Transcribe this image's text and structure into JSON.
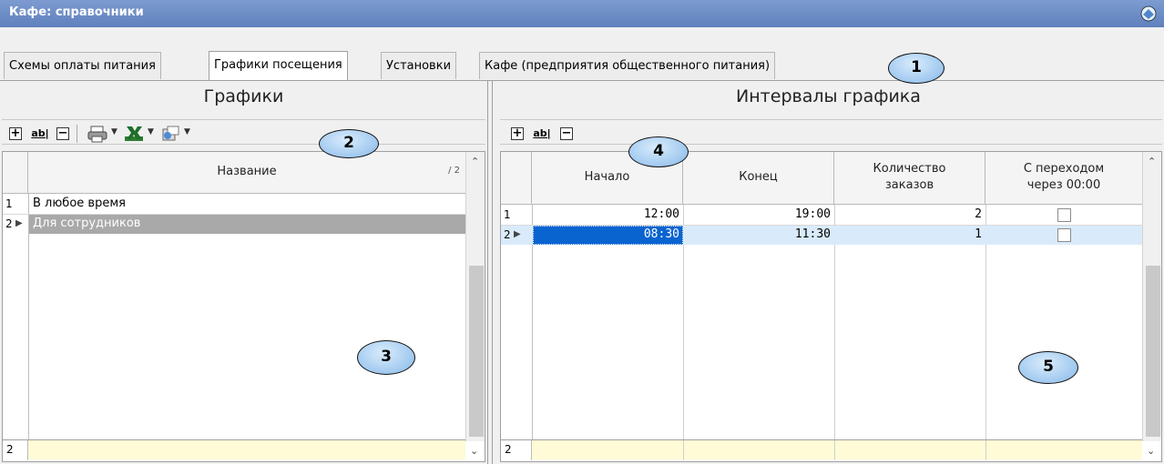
{
  "window": {
    "title": "Кафе: справочники",
    "icon": "app-icon"
  },
  "tabs": [
    {
      "label": "Схемы оплаты питания",
      "active": false
    },
    {
      "label": "Графики посещения",
      "active": true
    },
    {
      "label": "Установки",
      "active": false
    },
    {
      "label": "Кафе (предприятия общественного питания)",
      "active": false
    }
  ],
  "callouts": [
    "1",
    "2",
    "3",
    "4",
    "5"
  ],
  "left_panel": {
    "title": "Графики",
    "toolbar": {
      "add": "+",
      "edit": "ab|",
      "delete": "−",
      "print_icon": "printer-icon",
      "excel_icon": "excel-icon",
      "export_icon": "export-icon",
      "dropdown": "▼"
    },
    "columns": {
      "name": "Название",
      "count": "/ 2"
    },
    "rows": [
      {
        "num": "1",
        "name": "В любое время",
        "selected": false
      },
      {
        "num": "2",
        "name": "Для сотрудников",
        "selected": true
      }
    ],
    "footer_count": "2"
  },
  "right_panel": {
    "title": "Интервалы графика",
    "toolbar": {
      "add": "+",
      "edit": "ab|",
      "delete": "−"
    },
    "columns": {
      "start": "Начало",
      "end": "Конец",
      "orders_line1": "Количество",
      "orders_line2": "заказов",
      "midnight_line1": "С переходом",
      "midnight_line2": "через 00:00"
    },
    "rows": [
      {
        "num": "1",
        "start": "12:00",
        "end": "19:00",
        "orders": "2",
        "midnight": false
      },
      {
        "num": "2",
        "start": "08:30",
        "end": "11:30",
        "orders": "1",
        "midnight": false
      }
    ],
    "footer_count": "2"
  },
  "colors": {
    "titlebar": "#6a8ac5",
    "selected_row": "#a9a9a9",
    "selected_cell": "#0a64d0",
    "footer": "#fefbd6"
  }
}
